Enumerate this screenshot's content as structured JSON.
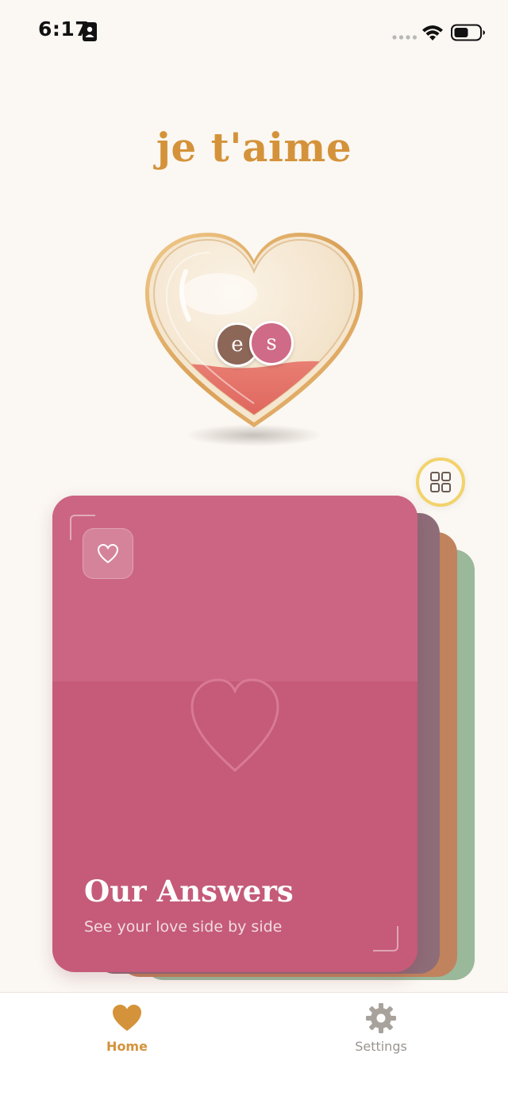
{
  "status_bar": {
    "time": "6:17"
  },
  "app": {
    "title": "je t'aime"
  },
  "avatars": {
    "first": "e",
    "second": "s"
  },
  "card": {
    "title": "Our Answers",
    "subtitle": "See your love side by side"
  },
  "tab_bar": {
    "home_label": "Home",
    "settings_label": "Settings"
  },
  "colors": {
    "accent": "#D4933A",
    "card_main": "#C55B79",
    "card_mauve": "#8E6D79",
    "card_orange": "#C1835E",
    "card_green": "#9AB89A",
    "grid_ring": "#F2D36A",
    "background": "#FBF7F2"
  },
  "icons": {
    "status_person": "person-id-icon",
    "wifi": "wifi-icon",
    "battery": "battery-icon",
    "grid": "grid-icon",
    "card_badge": "heart-outline-icon",
    "home": "heart-icon",
    "settings": "gear-icon"
  }
}
